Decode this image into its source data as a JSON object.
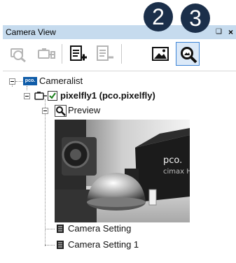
{
  "callouts": {
    "c2": "2",
    "c3": "3"
  },
  "window": {
    "title": "Camera View",
    "pin_glyph": "❑",
    "close_glyph": "×"
  },
  "toolbar": {
    "buttons": [
      {
        "icon": "zoom-camera-icon",
        "enabled": false
      },
      {
        "icon": "camera-connect-icon",
        "enabled": false
      },
      {
        "icon": "add-setting-icon",
        "enabled": true
      },
      {
        "icon": "remove-setting-icon",
        "enabled": false
      },
      {
        "icon": "image-view-icon",
        "enabled": true
      },
      {
        "icon": "preview-zoom-icon",
        "enabled": true,
        "active": true
      }
    ]
  },
  "tree": {
    "root": {
      "logo_text": "pco.",
      "label": "Cameralist"
    },
    "camera": {
      "label": "pixelfly1 (pco.pixelfly)",
      "checked": true
    },
    "preview": {
      "label": "Preview"
    },
    "settings": [
      {
        "label": "Camera Setting"
      },
      {
        "label": "Camera Setting 1"
      }
    ]
  },
  "preview_image": {
    "camera_brand": "pco.",
    "camera_model": "cimax H"
  },
  "colors": {
    "titlebar": "#c6dbee",
    "callout": "#1b2f4a",
    "active_button_border": "#3d84d6",
    "checkbox": "#1a7f1a"
  }
}
